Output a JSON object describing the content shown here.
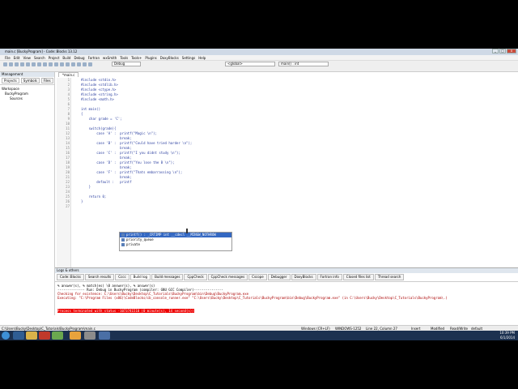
{
  "window": {
    "title": "main.c [BuckyProgram] - Code::Blocks 13.12"
  },
  "menu": [
    "File",
    "Edit",
    "View",
    "Search",
    "Project",
    "Build",
    "Debug",
    "Fortran",
    "wxSmith",
    "Tools",
    "Tools+",
    "Plugins",
    "DoxyBlocks",
    "Settings",
    "Help"
  ],
  "toolbar": {
    "build_target": "Debug",
    "scope": "<global>",
    "symbol": "main() : int"
  },
  "management": {
    "title": "Management",
    "tabs": [
      "Projects",
      "Symbols",
      "Files"
    ],
    "tree": {
      "workspace": "Workspace",
      "project": "BuckyProgram",
      "folder": "Sources"
    }
  },
  "editor": {
    "tab": "*main.c",
    "lines": [
      {
        "n": "1",
        "text": "#include <stdio.h>"
      },
      {
        "n": "2",
        "text": "#include <stdlib.h>"
      },
      {
        "n": "3",
        "text": "#include <ctype.h>"
      },
      {
        "n": "4",
        "text": "#include <string.h>"
      },
      {
        "n": "5",
        "text": "#include <math.h>"
      },
      {
        "n": "6",
        "text": ""
      },
      {
        "n": "7",
        "text": "int main()"
      },
      {
        "n": "8",
        "text": "{"
      },
      {
        "n": "9",
        "text": "    char grade = 'C';"
      },
      {
        "n": "10",
        "text": ""
      },
      {
        "n": "11",
        "text": "    switch(grade){"
      },
      {
        "n": "12",
        "text": "        case 'A' :  printf(\"Magic \\n\");"
      },
      {
        "n": "13",
        "text": "                    break;"
      },
      {
        "n": "14",
        "text": "        case 'B' :  printf(\"Could have tried harder \\n\");"
      },
      {
        "n": "15",
        "text": "                    break;"
      },
      {
        "n": "16",
        "text": "        case 'C' :  printf(\"I you didnt study \\n\");"
      },
      {
        "n": "17",
        "text": "                    break;"
      },
      {
        "n": "18",
        "text": "        case 'D' :  printf(\"You lose the B \\n\");"
      },
      {
        "n": "19",
        "text": "                    break;"
      },
      {
        "n": "20",
        "text": "        case 'F' :  printf(\"Thats embarrassing \\n\");"
      },
      {
        "n": "21",
        "text": "                    break;"
      },
      {
        "n": "22",
        "text": "        default :   printf"
      },
      {
        "n": "23",
        "text": "    }"
      },
      {
        "n": "24",
        "text": ""
      },
      {
        "n": "25",
        "text": "    return 0;"
      },
      {
        "n": "26",
        "text": "}"
      },
      {
        "n": "27",
        "text": ""
      }
    ]
  },
  "autocomplete": [
    "printf() : _CRTIMP int __cdecl __MINGW_NOTHROW",
    "priority_queue",
    "private"
  ],
  "logs": {
    "title": "Logs & others",
    "tabs": [
      "Code::Blocks",
      "Search results",
      "Cccc",
      "Build log",
      "Build messages",
      "CppCheck",
      "CppCheck messages",
      "Cscope",
      "Debugger",
      "DoxyBlocks",
      "Fortran info",
      "Closed files list",
      "Thread search"
    ],
    "active_tab": "Build log",
    "lines": [
      "% answer(s), % match(es) \\0 answer(s), % answer(s)",
      "",
      "-------------- Run: Debug in BuckyProgram (compiler: GNU GCC Compiler)---------------",
      "Checking for existence: C:\\Users\\Bucky\\Desktop\\C_Tutorials\\BuckyProgram\\bin\\Debug\\BuckyProgram.exe",
      "Executing: \"C:\\Program Files (x86)\\CodeBlocks/cb_console_runner.exe\" \"C:\\Users\\Bucky\\Desktop\\C_Tutorials\\BuckyProgram\\bin\\Debug\\BuckyProgram.exe\"  (in C:\\Users\\Bucky\\Desktop\\C_Tutorials\\BuckyProgram\\.)",
      "Process terminated with status -1073741510 (0 minute(s), 14 second(s))"
    ]
  },
  "status": {
    "path": "C:\\Users\\Bucky\\Desktop\\C_Tutorials\\BuckyProgram\\main.c",
    "line_endings": "Windows (CR+LF)",
    "encoding": "WINDOWS-1252",
    "position": "Line 22, Column 27",
    "mode": "Insert",
    "modified": "Modified",
    "access": "Read/Write",
    "profile": "default"
  },
  "taskbar": {
    "time": "10:39 PM",
    "date": "6/1/2014"
  }
}
